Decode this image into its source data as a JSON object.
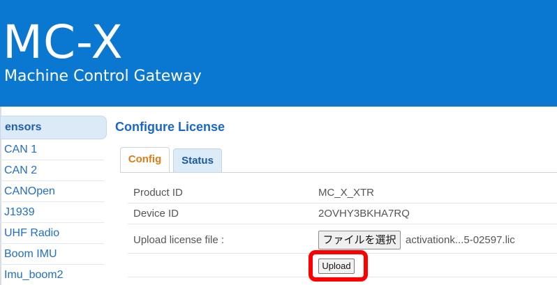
{
  "header": {
    "title": "MC-X",
    "subtitle": "Machine Control Gateway"
  },
  "sidebar": {
    "section_label": "ensors",
    "items": [
      {
        "label": "CAN 1"
      },
      {
        "label": "CAN 2"
      },
      {
        "label": "CANOpen"
      },
      {
        "label": "J1939"
      },
      {
        "label": "UHF Radio"
      },
      {
        "label": "Boom IMU"
      },
      {
        "label": "Imu_boom2"
      }
    ]
  },
  "main": {
    "title": "Configure License",
    "tabs": [
      {
        "label": "Config",
        "active": true
      },
      {
        "label": "Status",
        "active": false
      }
    ],
    "rows": [
      {
        "label": "Product ID",
        "value": "MC_X_XTR"
      },
      {
        "label": "Device ID",
        "value": "2OVHY3BKHA7RQ"
      },
      {
        "label": "Upload license file :"
      }
    ],
    "file_input": {
      "button_label": "ファイルを選択",
      "file_name": "activationk...5-02597.lic"
    },
    "upload_label": "Upload"
  },
  "colors": {
    "header_bg": "#0a78d1",
    "accent_link": "#1f6ec7",
    "active_tab": "#e27b11",
    "highlight": "#ff0000"
  }
}
